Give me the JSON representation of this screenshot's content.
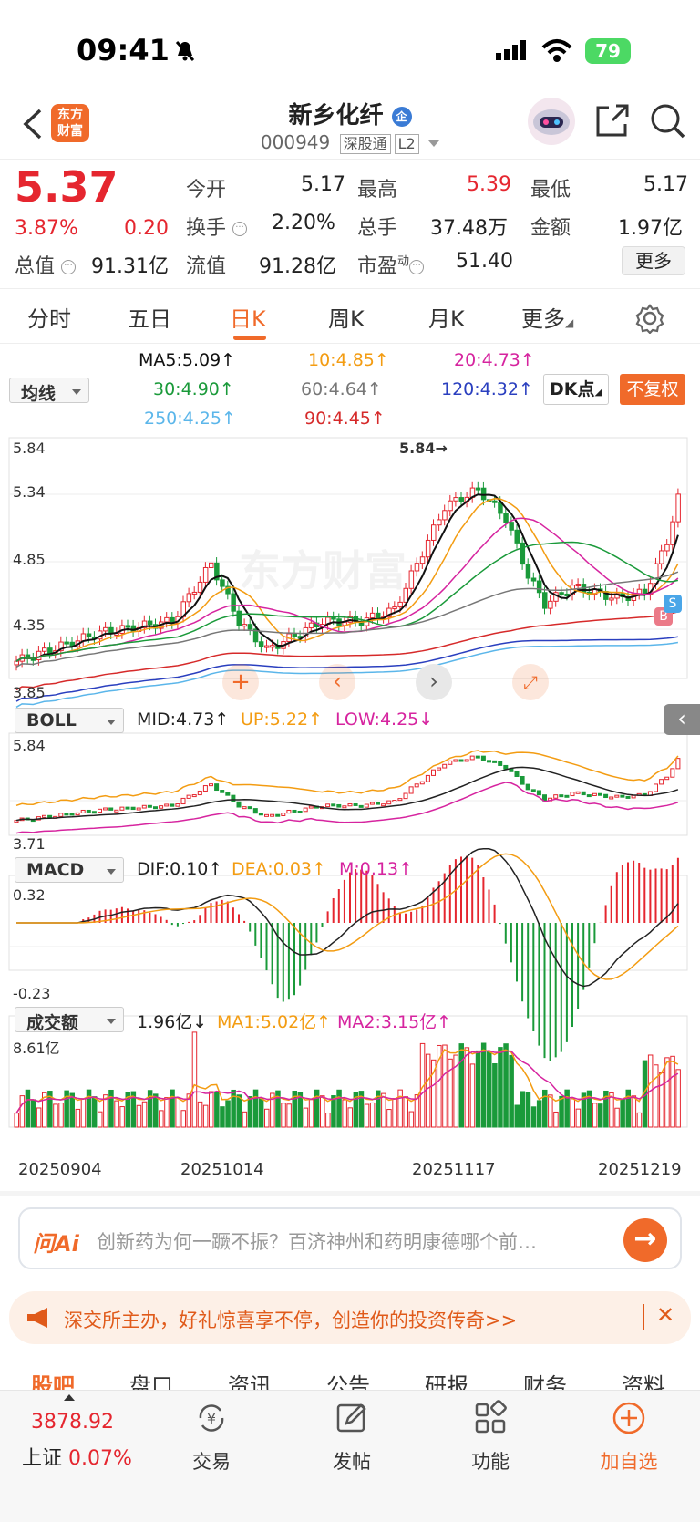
{
  "status": {
    "time": "09:41",
    "battery": "79"
  },
  "header": {
    "logo": "东方财富",
    "name": "新乡化纤",
    "name_badge": "企",
    "code": "000949",
    "exchange_tag": "深股通",
    "level_tag": "L2"
  },
  "quote": {
    "price": "5.37",
    "change_pct": "3.87%",
    "change": "0.20",
    "open_label": "今开",
    "open": "5.17",
    "high_label": "最高",
    "high": "5.39",
    "low_label": "最低",
    "low": "5.17",
    "turnover_label": "换手",
    "turnover": "2.20%",
    "volume_label": "总手",
    "volume": "37.48万",
    "amount_label": "金额",
    "amount": "1.97亿",
    "mktcap_label": "总值",
    "mktcap": "91.31亿",
    "float_label": "流值",
    "float": "91.28亿",
    "pe_label": "市盈",
    "pe_sup": "动",
    "pe": "51.40",
    "more": "更多"
  },
  "tabs": [
    "分时",
    "五日",
    "日K",
    "周K",
    "月K",
    "更多"
  ],
  "ma_panel": {
    "selector": "均线",
    "ma5": "MA5:5.09↑",
    "ma10": "10:4.85↑",
    "ma20": "20:4.73↑",
    "ma30": "30:4.90↑",
    "ma60": "60:4.64↑",
    "ma120": "120:4.32↑",
    "ma250": "250:4.25↑",
    "ma90": "90:4.45↑",
    "dk": "DK点",
    "fq": "不复权",
    "colors": {
      "ma5": "#111111",
      "ma10": "#f39c12",
      "ma20": "#d6249f",
      "ma30": "#1a9a3a",
      "ma60": "#777777",
      "ma120": "#2a3fbf",
      "ma250": "#5bb6ea",
      "ma90": "#d62a2a"
    }
  },
  "main_chart": {
    "y_top": "5.84",
    "y2": "5.34",
    "y3": "4.85",
    "y4": "4.35",
    "y_bottom": "3.85",
    "peak_label": "5.84→",
    "watermark": "东方财富",
    "b_marker": "B",
    "s_marker": "S"
  },
  "boll": {
    "selector": "BOLL",
    "mid": "MID:4.73↑",
    "up": "UP:5.22↑",
    "low": "LOW:4.25↓",
    "y_top": "5.84",
    "y_bottom": "3.71"
  },
  "macd": {
    "selector": "MACD",
    "dif": "DIF:0.10↑",
    "dea": "DEA:0.03↑",
    "m": "M:0.13↑",
    "y_top": "0.32",
    "y_bottom": "-0.23"
  },
  "vol": {
    "selector": "成交额",
    "value": "1.96亿↓",
    "ma1": "MA1:5.02亿↑",
    "ma2": "MA2:3.15亿↑",
    "y_top": "8.61亿"
  },
  "dates": [
    "20250904",
    "20251014",
    "20251117",
    "20251219"
  ],
  "ai": {
    "logo": "问Ai",
    "prompt": "创新药为何一蹶不振？百济神州和药明康德哪个前…"
  },
  "banner": {
    "text": "深交所主办，好礼惊喜享不停，创造你的投资传奇>>"
  },
  "bottom_tabs": [
    "股吧",
    "盘口",
    "资讯",
    "公告",
    "研报",
    "财务",
    "资料"
  ],
  "footer": {
    "index_value": "3878.92",
    "index_name": "上证",
    "index_change": "0.07%",
    "items": [
      "交易",
      "发帖",
      "功能",
      "加自选"
    ]
  }
}
